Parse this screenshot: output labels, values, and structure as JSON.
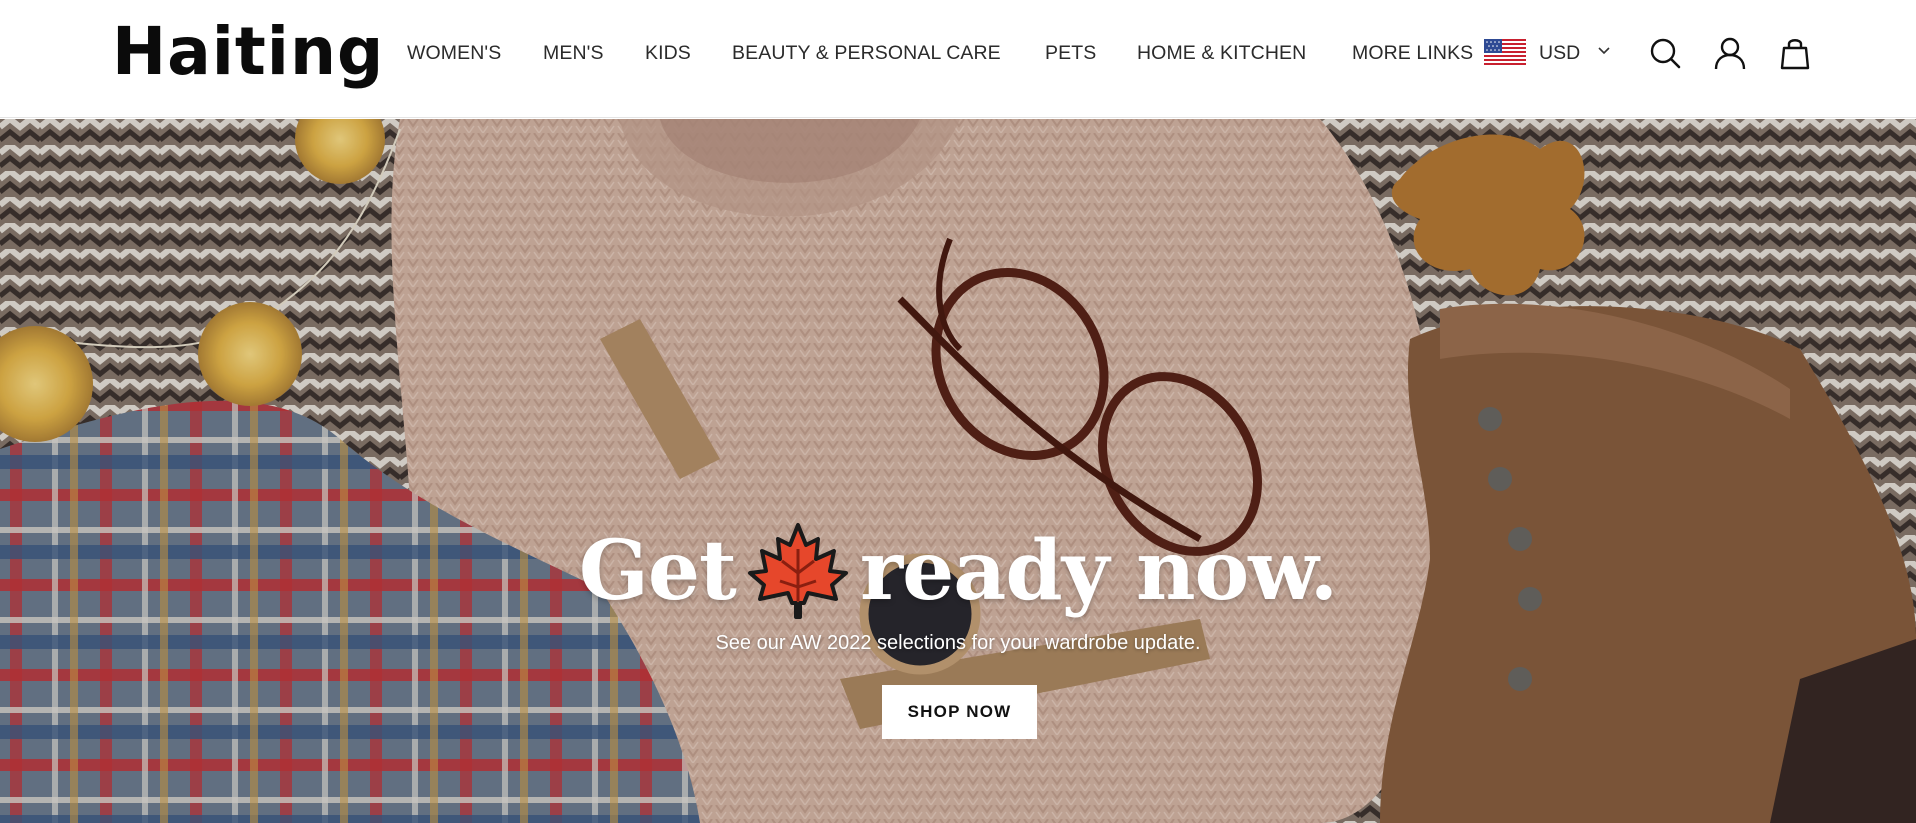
{
  "brand": {
    "logo_text": "Haiting"
  },
  "nav": {
    "items": [
      {
        "label": "WOMEN'S"
      },
      {
        "label": "MEN'S"
      },
      {
        "label": "KIDS"
      },
      {
        "label": "BEAUTY & PERSONAL CARE"
      },
      {
        "label": "PETS"
      },
      {
        "label": "HOME & KITCHEN"
      },
      {
        "label": "MORE LINKS"
      }
    ]
  },
  "currency": {
    "selected": "USD",
    "flag_icon": "us-flag-icon"
  },
  "header_icons": [
    "search-icon",
    "account-icon",
    "cart-bag-icon"
  ],
  "hero": {
    "title_before": "Get",
    "title_emoji": "maple-leaf-icon",
    "title_after": "ready now.",
    "subtitle": "See our AW 2022 selections for your wardrobe update.",
    "cta_label": "SHOP NOW"
  },
  "colors": {
    "leaf": "#e6472b",
    "header_bg": "#ffffff",
    "cta_bg": "#ffffff"
  }
}
